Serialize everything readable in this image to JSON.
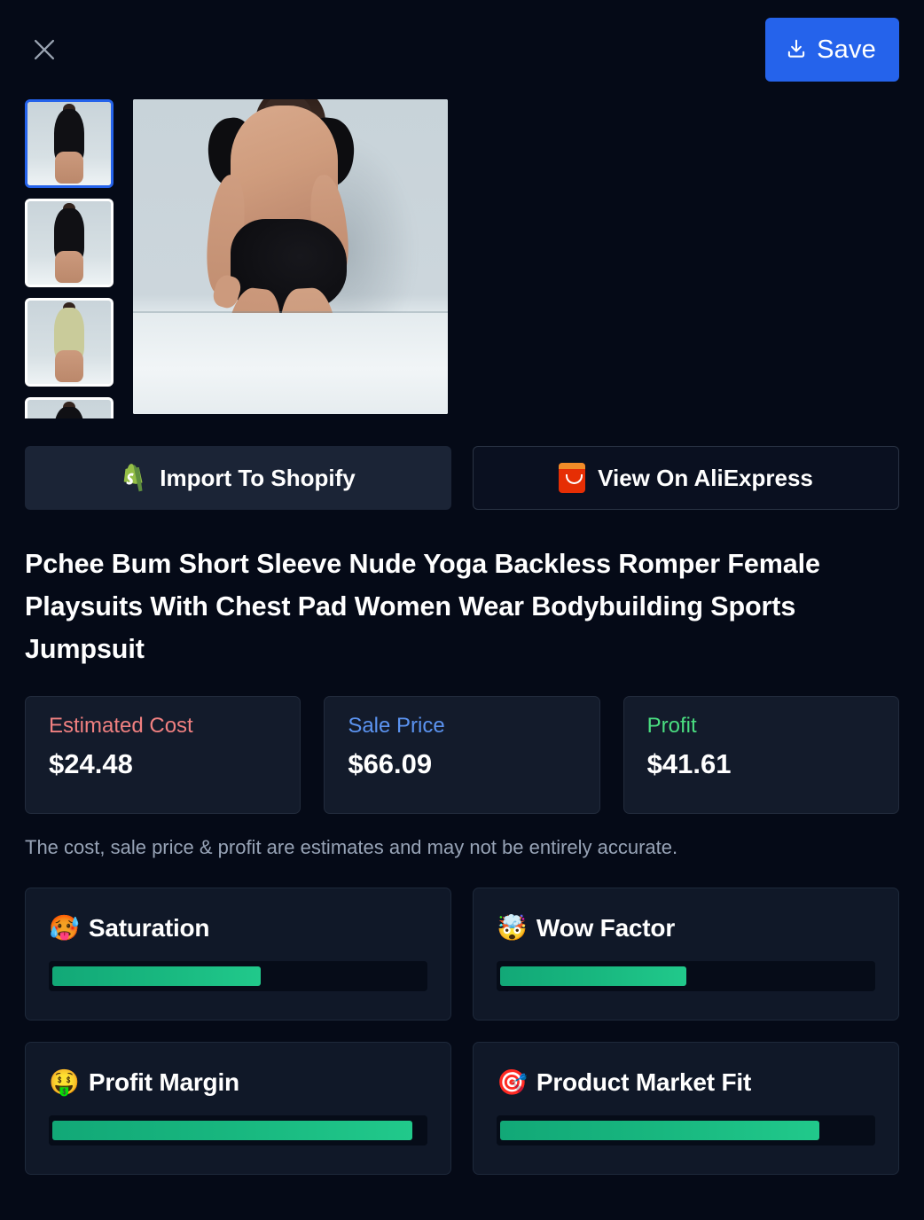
{
  "header": {
    "close_icon": "close-icon",
    "save_label": "Save",
    "save_icon": "download-icon",
    "save_color": "#2563EB"
  },
  "gallery": {
    "main_image_alt": "Black backless short sleeve romper rear view",
    "thumbnails": [
      {
        "alt": "Black romper rear view",
        "selected": true
      },
      {
        "alt": "Black romper front view",
        "selected": false
      },
      {
        "alt": "Olive romper front view",
        "selected": false
      },
      {
        "alt": "Black romper cropped view",
        "selected": false
      }
    ]
  },
  "actions": [
    {
      "label": "Import To Shopify",
      "icon": "shopify-icon"
    },
    {
      "label": "View On AliExpress",
      "icon": "aliexpress-icon"
    }
  ],
  "product": {
    "title": "Pchee Bum Short Sleeve Nude Yoga Backless Romper Female Playsuits With Chest Pad Women Wear Bodybuilding Sports Jumpsuit"
  },
  "pricing": {
    "cards": [
      {
        "label": "Estimated Cost",
        "value": "$24.48",
        "color": "#F08080"
      },
      {
        "label": "Sale Price",
        "value": "$66.09",
        "color": "#5B93F0"
      },
      {
        "label": "Profit",
        "value": "$41.61",
        "color": "#4ADE80"
      }
    ],
    "disclaimer": "The cost, sale price & profit are estimates and may not be entirely accurate."
  },
  "metrics": [
    {
      "emoji": "🥵",
      "icon": "hot-face-icon",
      "label": "Saturation",
      "percent": 56
    },
    {
      "emoji": "🤯",
      "icon": "exploding-head-icon",
      "label": "Wow Factor",
      "percent": 50
    },
    {
      "emoji": "🤑",
      "icon": "money-face-icon",
      "label": "Profit Margin",
      "percent": 97
    },
    {
      "emoji": "🎯",
      "icon": "target-icon",
      "label": "Product Market Fit",
      "percent": 86
    }
  ]
}
